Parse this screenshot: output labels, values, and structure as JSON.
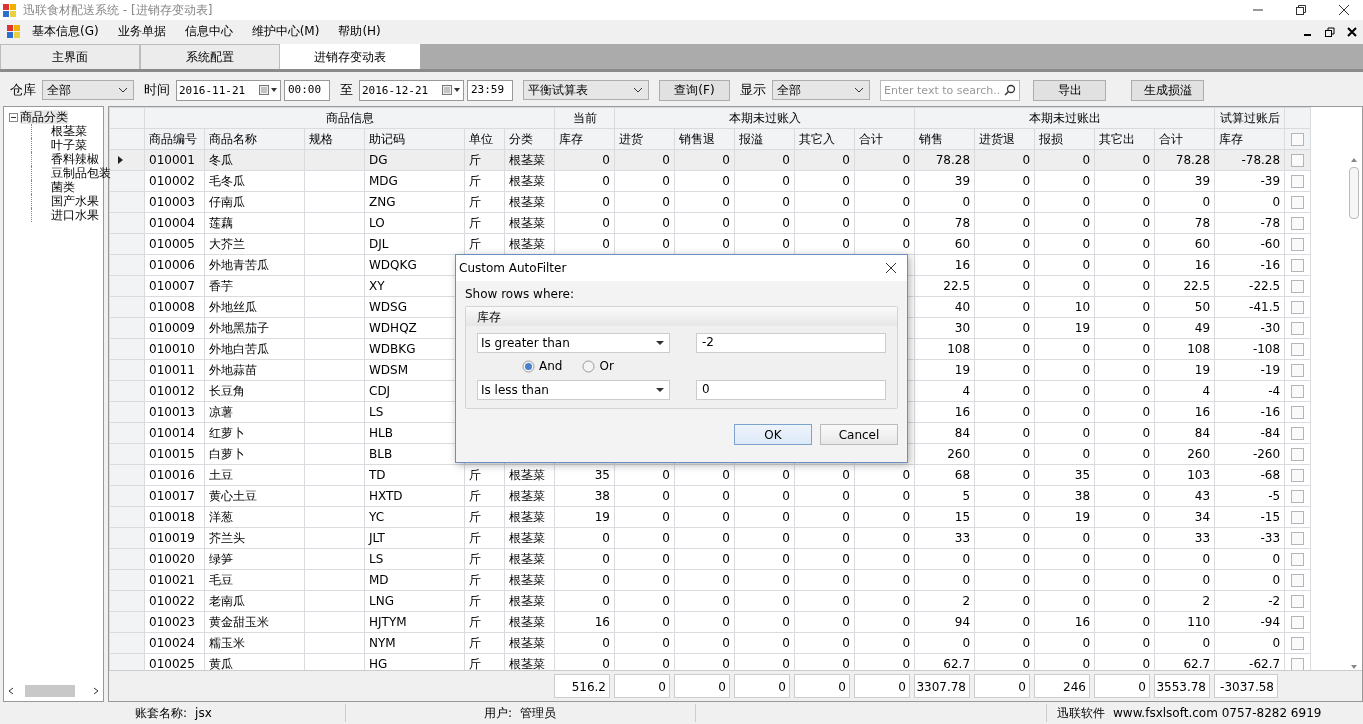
{
  "window": {
    "title": "迅联食材配送系统 - [进销存变动表]"
  },
  "menu": [
    {
      "label": "基本信息(G)"
    },
    {
      "label": "业务单据"
    },
    {
      "label": "信息中心"
    },
    {
      "label": "维护中心(M)"
    },
    {
      "label": "帮助(H)"
    }
  ],
  "tabs": [
    {
      "label": "主界面",
      "selected": false
    },
    {
      "label": "系统配置",
      "selected": false
    },
    {
      "label": "进销存变动表",
      "selected": true
    }
  ],
  "toolbar": {
    "warehouse_label": "仓库",
    "warehouse": "全部",
    "time_label": "时间",
    "date_from": "2016-11-21",
    "time_from": "00:00",
    "to_label": "至",
    "date_to": "2016-12-21",
    "time_to": "23:59",
    "report": "平衡试算表",
    "query_button": "查询(F)",
    "show_label": "显示",
    "show": "全部",
    "search_placeholder": "Enter text to search..",
    "export_button": "导出",
    "loss_button": "生成损溢"
  },
  "tree": {
    "label": "商品分类",
    "expanded": true,
    "children": [
      {
        "label": "根茎菜"
      },
      {
        "label": "叶子菜"
      },
      {
        "label": "香料辣椒"
      },
      {
        "label": "豆制品包装"
      },
      {
        "label": "菌类"
      },
      {
        "label": "国产水果"
      },
      {
        "label": "进口水果"
      }
    ]
  },
  "grid": {
    "groups": [
      {
        "label": "商品信息"
      },
      {
        "label": "当前"
      },
      {
        "label": "本期未过账入"
      },
      {
        "label": "本期未过账出"
      },
      {
        "label": "试算过账后"
      }
    ],
    "columns": [
      "商品编号",
      "商品名称",
      "规格",
      "助记码",
      "单位",
      "分类",
      "库存",
      "进货",
      "销售退",
      "报溢",
      "其它入",
      "合计",
      "销售",
      "进货退",
      "报损",
      "其它出",
      "合计",
      "库存"
    ],
    "select_all_checked": false,
    "rows": [
      {
        "selected": true,
        "checked": false,
        "cells": [
          "010001",
          "冬瓜",
          "",
          "DG",
          "斤",
          "根茎菜",
          "0",
          "0",
          "0",
          "0",
          "0",
          "0",
          "78.28",
          "0",
          "0",
          "0",
          "78.28",
          "-78.28"
        ]
      },
      {
        "selected": false,
        "checked": false,
        "cells": [
          "010002",
          "毛冬瓜",
          "",
          "MDG",
          "斤",
          "根茎菜",
          "0",
          "0",
          "0",
          "0",
          "0",
          "0",
          "39",
          "0",
          "0",
          "0",
          "39",
          "-39"
        ]
      },
      {
        "selected": false,
        "checked": false,
        "cells": [
          "010003",
          "仔南瓜",
          "",
          "ZNG",
          "斤",
          "根茎菜",
          "0",
          "0",
          "0",
          "0",
          "0",
          "0",
          "0",
          "0",
          "0",
          "0",
          "0",
          "0"
        ]
      },
      {
        "selected": false,
        "checked": false,
        "cells": [
          "010004",
          "莲藕",
          "",
          "LO",
          "斤",
          "根茎菜",
          "0",
          "0",
          "0",
          "0",
          "0",
          "0",
          "78",
          "0",
          "0",
          "0",
          "78",
          "-78"
        ]
      },
      {
        "selected": false,
        "checked": false,
        "cells": [
          "010005",
          "大芥兰",
          "",
          "DJL",
          "斤",
          "根茎菜",
          "0",
          "0",
          "0",
          "0",
          "0",
          "0",
          "60",
          "0",
          "0",
          "0",
          "60",
          "-60"
        ]
      },
      {
        "selected": false,
        "checked": false,
        "cells": [
          "010006",
          "外地青苦瓜",
          "",
          "WDQKG",
          null,
          null,
          null,
          null,
          null,
          null,
          null,
          null,
          "16",
          "0",
          "0",
          "0",
          "16",
          "-16"
        ]
      },
      {
        "selected": false,
        "checked": false,
        "cells": [
          "010007",
          "香芋",
          "",
          "XY",
          null,
          null,
          null,
          null,
          null,
          null,
          null,
          null,
          "22.5",
          "0",
          "0",
          "0",
          "22.5",
          "-22.5"
        ]
      },
      {
        "selected": false,
        "checked": false,
        "cells": [
          "010008",
          "外地丝瓜",
          "",
          "WDSG",
          null,
          null,
          null,
          null,
          null,
          null,
          null,
          null,
          "40",
          "0",
          "10",
          "0",
          "50",
          "-41.5"
        ]
      },
      {
        "selected": false,
        "checked": false,
        "cells": [
          "010009",
          "外地黑茄子",
          "",
          "WDHQZ",
          null,
          null,
          null,
          null,
          null,
          null,
          null,
          null,
          "30",
          "0",
          "19",
          "0",
          "49",
          "-30"
        ]
      },
      {
        "selected": false,
        "checked": false,
        "cells": [
          "010010",
          "外地白苦瓜",
          "",
          "WDBKG",
          null,
          null,
          null,
          null,
          null,
          null,
          null,
          null,
          "108",
          "0",
          "0",
          "0",
          "108",
          "-108"
        ]
      },
      {
        "selected": false,
        "checked": false,
        "cells": [
          "010011",
          "外地蒜苗",
          "",
          "WDSM",
          null,
          null,
          null,
          null,
          null,
          null,
          null,
          null,
          "19",
          "0",
          "0",
          "0",
          "19",
          "-19"
        ]
      },
      {
        "selected": false,
        "checked": false,
        "cells": [
          "010012",
          "长豆角",
          "",
          "CDJ",
          null,
          null,
          null,
          null,
          null,
          null,
          null,
          null,
          "4",
          "0",
          "0",
          "0",
          "4",
          "-4"
        ]
      },
      {
        "selected": false,
        "checked": false,
        "cells": [
          "010013",
          "凉薯",
          "",
          "LS",
          null,
          null,
          null,
          null,
          null,
          null,
          null,
          null,
          "16",
          "0",
          "0",
          "0",
          "16",
          "-16"
        ]
      },
      {
        "selected": false,
        "checked": false,
        "cells": [
          "010014",
          "红萝卜",
          "",
          "HLB",
          null,
          null,
          null,
          null,
          null,
          null,
          null,
          null,
          "84",
          "0",
          "0",
          "0",
          "84",
          "-84"
        ]
      },
      {
        "selected": false,
        "checked": false,
        "cells": [
          "010015",
          "白萝卜",
          "",
          "BLB",
          null,
          null,
          null,
          null,
          null,
          null,
          null,
          null,
          "260",
          "0",
          "0",
          "0",
          "260",
          "-260"
        ]
      },
      {
        "selected": false,
        "checked": false,
        "cells": [
          "010016",
          "土豆",
          "",
          "TD",
          "斤",
          "根茎菜",
          "35",
          "0",
          "0",
          "0",
          "0",
          "0",
          "68",
          "0",
          "35",
          "0",
          "103",
          "-68"
        ]
      },
      {
        "selected": false,
        "checked": false,
        "cells": [
          "010017",
          "黄心土豆",
          "",
          "HXTD",
          "斤",
          "根茎菜",
          "38",
          "0",
          "0",
          "0",
          "0",
          "0",
          "5",
          "0",
          "38",
          "0",
          "43",
          "-5"
        ]
      },
      {
        "selected": false,
        "checked": false,
        "cells": [
          "010018",
          "洋葱",
          "",
          "YC",
          "斤",
          "根茎菜",
          "19",
          "0",
          "0",
          "0",
          "0",
          "0",
          "15",
          "0",
          "19",
          "0",
          "34",
          "-15"
        ]
      },
      {
        "selected": false,
        "checked": false,
        "cells": [
          "010019",
          "芥兰头",
          "",
          "JLT",
          "斤",
          "根茎菜",
          "0",
          "0",
          "0",
          "0",
          "0",
          "0",
          "33",
          "0",
          "0",
          "0",
          "33",
          "-33"
        ]
      },
      {
        "selected": false,
        "checked": false,
        "cells": [
          "010020",
          "绿笋",
          "",
          "LS",
          "斤",
          "根茎菜",
          "0",
          "0",
          "0",
          "0",
          "0",
          "0",
          "0",
          "0",
          "0",
          "0",
          "0",
          "0"
        ]
      },
      {
        "selected": false,
        "checked": false,
        "cells": [
          "010021",
          "毛豆",
          "",
          "MD",
          "斤",
          "根茎菜",
          "0",
          "0",
          "0",
          "0",
          "0",
          "0",
          "0",
          "0",
          "0",
          "0",
          "0",
          "0"
        ]
      },
      {
        "selected": false,
        "checked": false,
        "cells": [
          "010022",
          "老南瓜",
          "",
          "LNG",
          "斤",
          "根茎菜",
          "0",
          "0",
          "0",
          "0",
          "0",
          "0",
          "2",
          "0",
          "0",
          "0",
          "2",
          "-2"
        ]
      },
      {
        "selected": false,
        "checked": false,
        "cells": [
          "010023",
          "黄金甜玉米",
          "",
          "HJTYM",
          "斤",
          "根茎菜",
          "16",
          "0",
          "0",
          "0",
          "0",
          "0",
          "94",
          "0",
          "16",
          "0",
          "110",
          "-94"
        ]
      },
      {
        "selected": false,
        "checked": false,
        "cells": [
          "010024",
          "糯玉米",
          "",
          "NYM",
          "斤",
          "根茎菜",
          "0",
          "0",
          "0",
          "0",
          "0",
          "0",
          "0",
          "0",
          "0",
          "0",
          "0",
          "0"
        ]
      },
      {
        "selected": false,
        "checked": false,
        "cells": [
          "010025",
          "黄瓜",
          "",
          "HG",
          "斤",
          "根茎菜",
          "0",
          "0",
          "0",
          "0",
          "0",
          "0",
          "62.7",
          "0",
          "0",
          "0",
          "62.7",
          "-62.7"
        ]
      }
    ],
    "totals": [
      "516.2",
      "0",
      "0",
      "0",
      "0",
      "0",
      "3307.78",
      "0",
      "246",
      "0",
      "3553.78",
      "-3037.58"
    ]
  },
  "dialog": {
    "title": "Custom AutoFilter",
    "prompt": "Show rows where:",
    "field": "库存",
    "conditions": [
      {
        "operator": "Is greater than",
        "value": "-2"
      },
      {
        "operator": "Is less than",
        "value": "0"
      }
    ],
    "logic": [
      {
        "label": "And",
        "selected": true
      },
      {
        "label": "Or",
        "selected": false
      }
    ],
    "buttons": [
      {
        "label": "OK",
        "default": true
      },
      {
        "label": "Cancel",
        "default": false
      }
    ]
  },
  "status_bar": {
    "account_label": "账套名称:",
    "account": "jsx",
    "user_label": "用户:",
    "user": "管理员",
    "company": "迅联软件",
    "contact": "www.fsxlsoft.com 0757-8282 6919"
  }
}
